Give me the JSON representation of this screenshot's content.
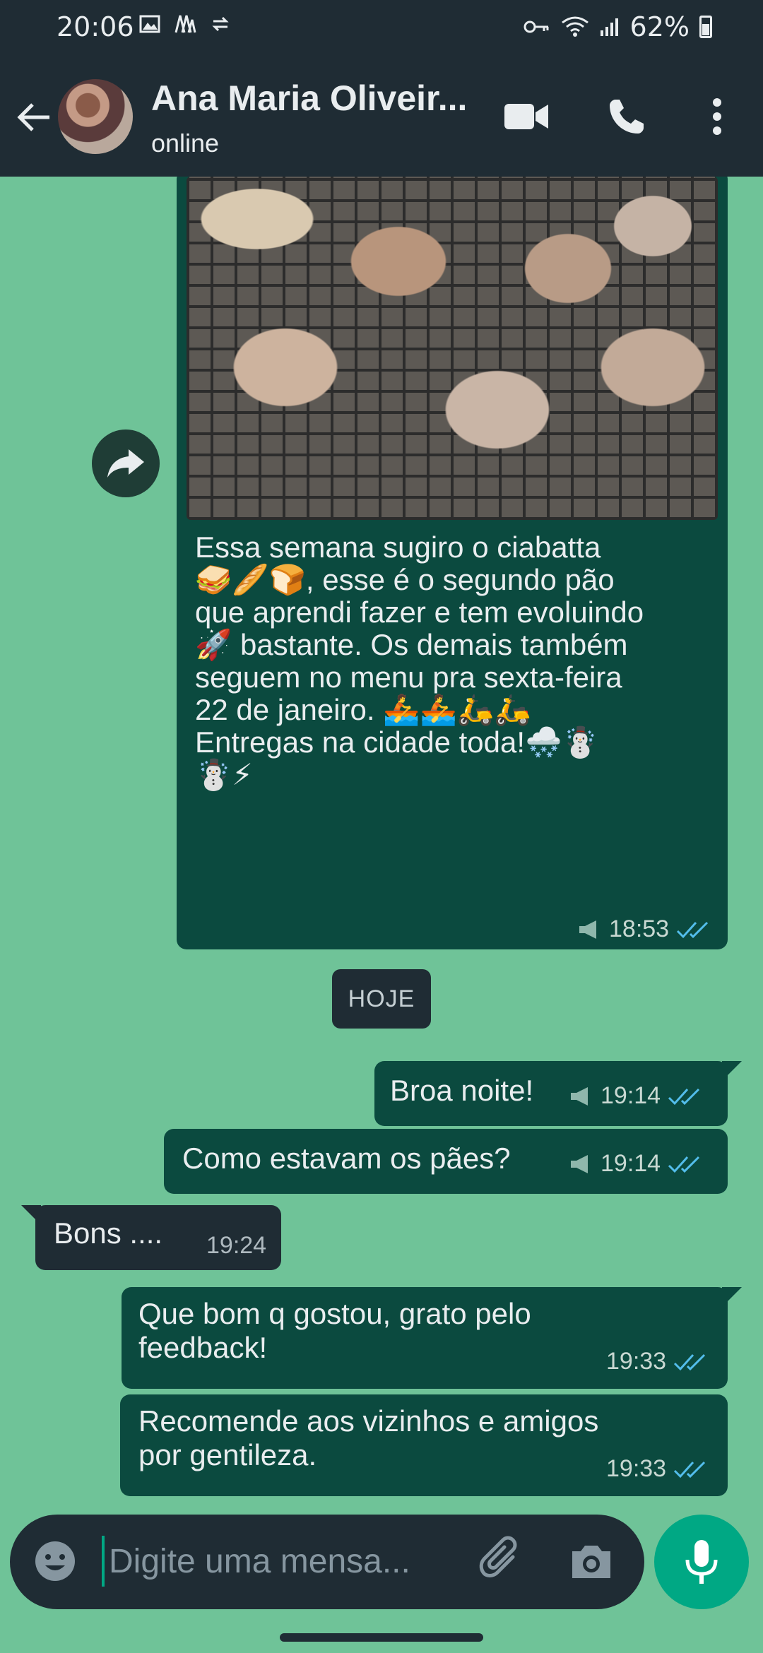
{
  "status_bar": {
    "time": "20:06",
    "battery": "62%",
    "left_icons": [
      "image-icon",
      "maps-icon",
      "sync-icon"
    ],
    "right_icons": [
      "key-icon",
      "wifi-icon",
      "signal-icon",
      "battery-icon"
    ]
  },
  "header": {
    "contact_name": "Ana Maria Oliveir...",
    "status": "online",
    "icons": [
      "back-arrow-icon",
      "video-call-icon",
      "voice-call-icon",
      "more-vert-icon"
    ]
  },
  "messages": {
    "image_post": {
      "caption": "Essa semana sugiro o ciabatta\n🥪🥖🍞, esse é o segundo pão\nque aprendi fazer e tem evoluindo\n🚀 bastante. Os demais também\nseguem no menu pra sexta-feira\n22 de janeiro. 🚣🚣🛵🛵\nEntregas na cidade toda!🌨️☃️\n☃️⚡",
      "time": "18:53"
    },
    "date_divider": "HOJE",
    "m1": {
      "text": "Broa noite!",
      "time": "19:14"
    },
    "m2": {
      "text": "Como estavam os pães?",
      "time": "19:14"
    },
    "m3": {
      "text": "Bons ....",
      "time": "19:24"
    },
    "m4": {
      "text": "Que bom q gostou, grato pelo\nfeedback!",
      "time": "19:33"
    },
    "m5": {
      "text": "Recomende aos vizinhos e amigos\npor gentileza.",
      "time": "19:33"
    }
  },
  "composer": {
    "placeholder": "Digite uma mensa...",
    "value": ""
  },
  "colors": {
    "chat_background": "#6fc398",
    "outgoing_bubble": "#0b4a3f",
    "incoming_bubble": "#1f2c34",
    "bar": "#1f2c34",
    "accent": "#00a884",
    "read_tick": "#53bdeb"
  }
}
